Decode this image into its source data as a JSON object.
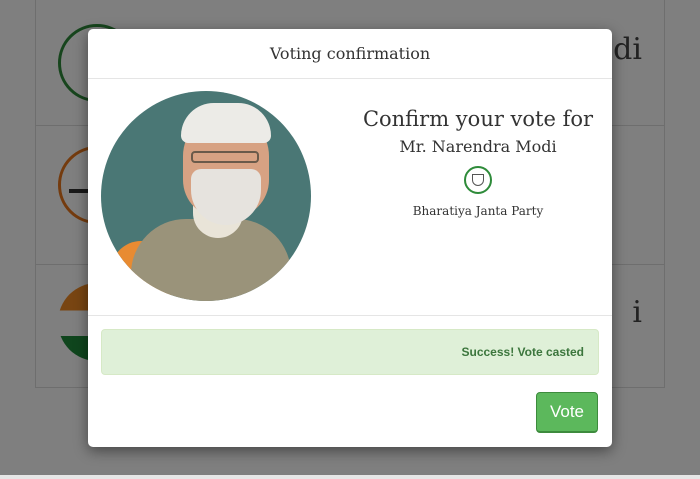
{
  "background": {
    "rows": [
      {
        "name_fragment": "odi"
      },
      {
        "name_fragment": ""
      },
      {
        "name_fragment": "i"
      }
    ]
  },
  "modal": {
    "title": "Voting confirmation",
    "confirm_heading": "Confirm your vote for",
    "candidate_name": "Mr. Narendra Modi",
    "party_symbol_icon": "lotus-party-symbol",
    "party_name": "Bharatiya Janta Party",
    "alert": {
      "message": "Success! Vote casted",
      "color": "#3c763d",
      "background": "#dff0d8"
    },
    "vote_button": {
      "label": "Vote",
      "color": "#5cb85c"
    }
  }
}
